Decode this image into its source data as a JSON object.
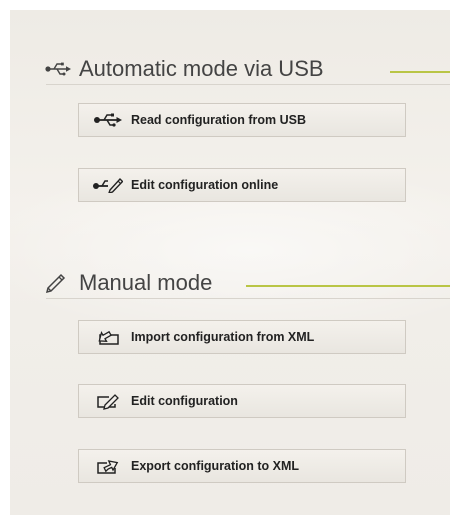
{
  "automatic": {
    "title": "Automatic mode via USB",
    "icon": "usb-icon",
    "buttons": [
      {
        "label": "Read configuration from USB",
        "icon": "usb-icon"
      },
      {
        "label": "Edit configuration online",
        "icon": "usb-edit-icon"
      }
    ]
  },
  "manual": {
    "title": "Manual mode",
    "icon": "pencil-icon",
    "buttons": [
      {
        "label": "Import configuration from XML",
        "icon": "import-icon"
      },
      {
        "label": "Edit configuration",
        "icon": "edit-icon"
      },
      {
        "label": "Export configuration to XML",
        "icon": "export-icon"
      }
    ]
  },
  "colors": {
    "accent": "#b9c545",
    "panel": "#efece7",
    "text": "#444444"
  }
}
